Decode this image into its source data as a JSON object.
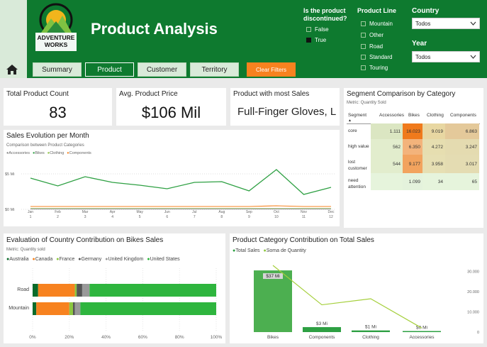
{
  "header": {
    "title": "Product Analysis",
    "logo_text_1": "ADVENTURE",
    "logo_text_2": "WORKS",
    "discontinued_label_1": "Is the product",
    "discontinued_label_2": "discontinued?",
    "discontinued_options": [
      {
        "label": "False",
        "checked": false
      },
      {
        "label": "True",
        "checked": true
      }
    ],
    "product_line_label": "Product Line",
    "product_line_options": [
      "Mountain",
      "Other",
      "Road",
      "Standard",
      "Touring"
    ],
    "country_label": "Country",
    "country_value": "Todos",
    "year_label": "Year",
    "year_value": "Todos"
  },
  "nav": {
    "tabs": [
      {
        "label": "Summary",
        "active": false
      },
      {
        "label": "Product",
        "active": true
      },
      {
        "label": "Customer",
        "active": false
      },
      {
        "label": "Territory",
        "active": false
      }
    ],
    "clear_label": "Clear Filters"
  },
  "kpis": {
    "count_title": "Total Product Count",
    "count_value": "83",
    "price_title": "Avg. Product Price",
    "price_value": "$106 Mil",
    "top_title": "Product with most Sales",
    "top_value": "Full-Finger Gloves, L"
  },
  "segment": {
    "title": "Segment Comparison by Category",
    "metric": "Metric: Quantity Sold",
    "columns": [
      "Segment",
      "Accessories",
      "Bikes",
      "Clothing",
      "Components"
    ],
    "rows": [
      {
        "segment": "core",
        "values": [
          "1.111",
          "16.023",
          "9.019",
          "6.863"
        ]
      },
      {
        "segment": "high value",
        "values": [
          "562",
          "6.350",
          "4.272",
          "3.247"
        ]
      },
      {
        "segment": "lost customer",
        "values": [
          "544",
          "9.177",
          "3.958",
          "3.017"
        ]
      },
      {
        "segment": "need attention",
        "values": [
          "",
          "1.099",
          "34",
          "65"
        ]
      }
    ],
    "cell_colors": [
      [
        "#dbe6c2",
        "#f07a1c",
        "#e8d7a2",
        "#e4c99a"
      ],
      [
        "#e2edcd",
        "#f3b37b",
        "#e6deb0",
        "#e4dbb0"
      ],
      [
        "#e2edcd",
        "#f2a35e",
        "#e6dfb3",
        "#e4dcb2"
      ],
      [
        "#e6f4dc",
        "#e4f2dc",
        "#e6f4dc",
        "#e6f4dc"
      ]
    ]
  },
  "sales_evolution": {
    "title": "Sales Evolution per Month",
    "subtitle": "Comparison between Product Categories",
    "legend": [
      {
        "label": "Accessories",
        "color": "#888888"
      },
      {
        "label": "Bikes",
        "color": "#2ea043"
      },
      {
        "label": "Clothing",
        "color": "#8cc63f"
      },
      {
        "label": "Components",
        "color": "#f7821f"
      }
    ],
    "y_ticks": [
      "$5 Mi",
      "$0 Mi"
    ],
    "months": [
      {
        "m": "Jan",
        "n": "1"
      },
      {
        "m": "Feb",
        "n": "2"
      },
      {
        "m": "Mar",
        "n": "3"
      },
      {
        "m": "Apr",
        "n": "4"
      },
      {
        "m": "May",
        "n": "5"
      },
      {
        "m": "Jun",
        "n": "6"
      },
      {
        "m": "Jul",
        "n": "7"
      },
      {
        "m": "Aug",
        "n": "8"
      },
      {
        "m": "Sep",
        "n": "9"
      },
      {
        "m": "Oct",
        "n": "10"
      },
      {
        "m": "Nov",
        "n": "11"
      },
      {
        "m": "Dec",
        "n": "12"
      }
    ]
  },
  "country_contrib": {
    "title": "Evaluation of Country Contribution on Bikes Sales",
    "metric": "Metric: Quantity sold",
    "x_ticks": [
      "0%",
      "20%",
      "40%",
      "60%",
      "80%",
      "100%"
    ]
  },
  "category_contrib": {
    "title": "Product Category Contribution on Total Sales",
    "legend": [
      {
        "label": "Total Sales",
        "color": "#2ea043"
      },
      {
        "label": "Soma de Quantity",
        "color": "#8cc63f"
      }
    ],
    "y2_ticks": [
      "30.000",
      "20.000",
      "10.000",
      "0"
    ]
  },
  "chart_data": [
    {
      "type": "line",
      "title": "Sales Evolution per Month",
      "x": [
        "Jan",
        "Feb",
        "Mar",
        "Apr",
        "May",
        "Jun",
        "Jul",
        "Aug",
        "Sep",
        "Oct",
        "Nov",
        "Dec"
      ],
      "ylim": [
        0,
        7
      ],
      "series": [
        {
          "name": "Bikes",
          "values": [
            4.4,
            3.3,
            4.6,
            3.8,
            3.4,
            2.9,
            3.8,
            3.9,
            2.6,
            5.6,
            2.1,
            3.1
          ]
        },
        {
          "name": "Components",
          "values": [
            0.4,
            0.4,
            0.4,
            0.4,
            0.4,
            0.4,
            0.4,
            0.4,
            0.4,
            0.5,
            0.4,
            0.4
          ]
        },
        {
          "name": "Clothing",
          "values": [
            0.1,
            0.1,
            0.1,
            0.1,
            0.1,
            0.1,
            0.1,
            0.1,
            0.1,
            0.1,
            0.1,
            0.1
          ]
        },
        {
          "name": "Accessories",
          "values": [
            0.05,
            0.05,
            0.05,
            0.05,
            0.05,
            0.05,
            0.05,
            0.05,
            0.05,
            0.05,
            0.05,
            0.05
          ]
        }
      ]
    },
    {
      "type": "bar",
      "title": "Evaluation of Country Contribution on Bikes Sales",
      "categories": [
        "Road",
        "Mountain"
      ],
      "stacked": true,
      "horizontal": true,
      "xlim": [
        0,
        100
      ],
      "series": [
        {
          "name": "Australia",
          "color": "#0b6b2a",
          "values": [
            3,
            2
          ]
        },
        {
          "name": "Canada",
          "color": "#f7821f",
          "values": [
            20,
            18
          ]
        },
        {
          "name": "France",
          "color": "#8cc63f",
          "values": [
            1,
            2
          ]
        },
        {
          "name": "Germany",
          "color": "#555555",
          "values": [
            3,
            1
          ]
        },
        {
          "name": "United Kingdom",
          "color": "#999999",
          "values": [
            4,
            3
          ]
        },
        {
          "name": "United States",
          "color": "#2eb53e",
          "values": [
            69,
            74
          ]
        }
      ]
    },
    {
      "type": "bar",
      "title": "Product Category Contribution on Total Sales",
      "categories": [
        "Bikes",
        "Components",
        "Clothing",
        "Accessories"
      ],
      "series": [
        {
          "name": "Total Sales",
          "values": [
            37,
            3,
            1,
            0
          ],
          "labels": [
            "$37 Mi",
            "$3 Mi",
            "$1 Mi",
            "$0 Mi"
          ]
        },
        {
          "name": "Soma de Quantity",
          "values": [
            33000,
            13500,
            16500,
            2000
          ]
        }
      ],
      "y2lim": [
        0,
        33000
      ]
    }
  ]
}
